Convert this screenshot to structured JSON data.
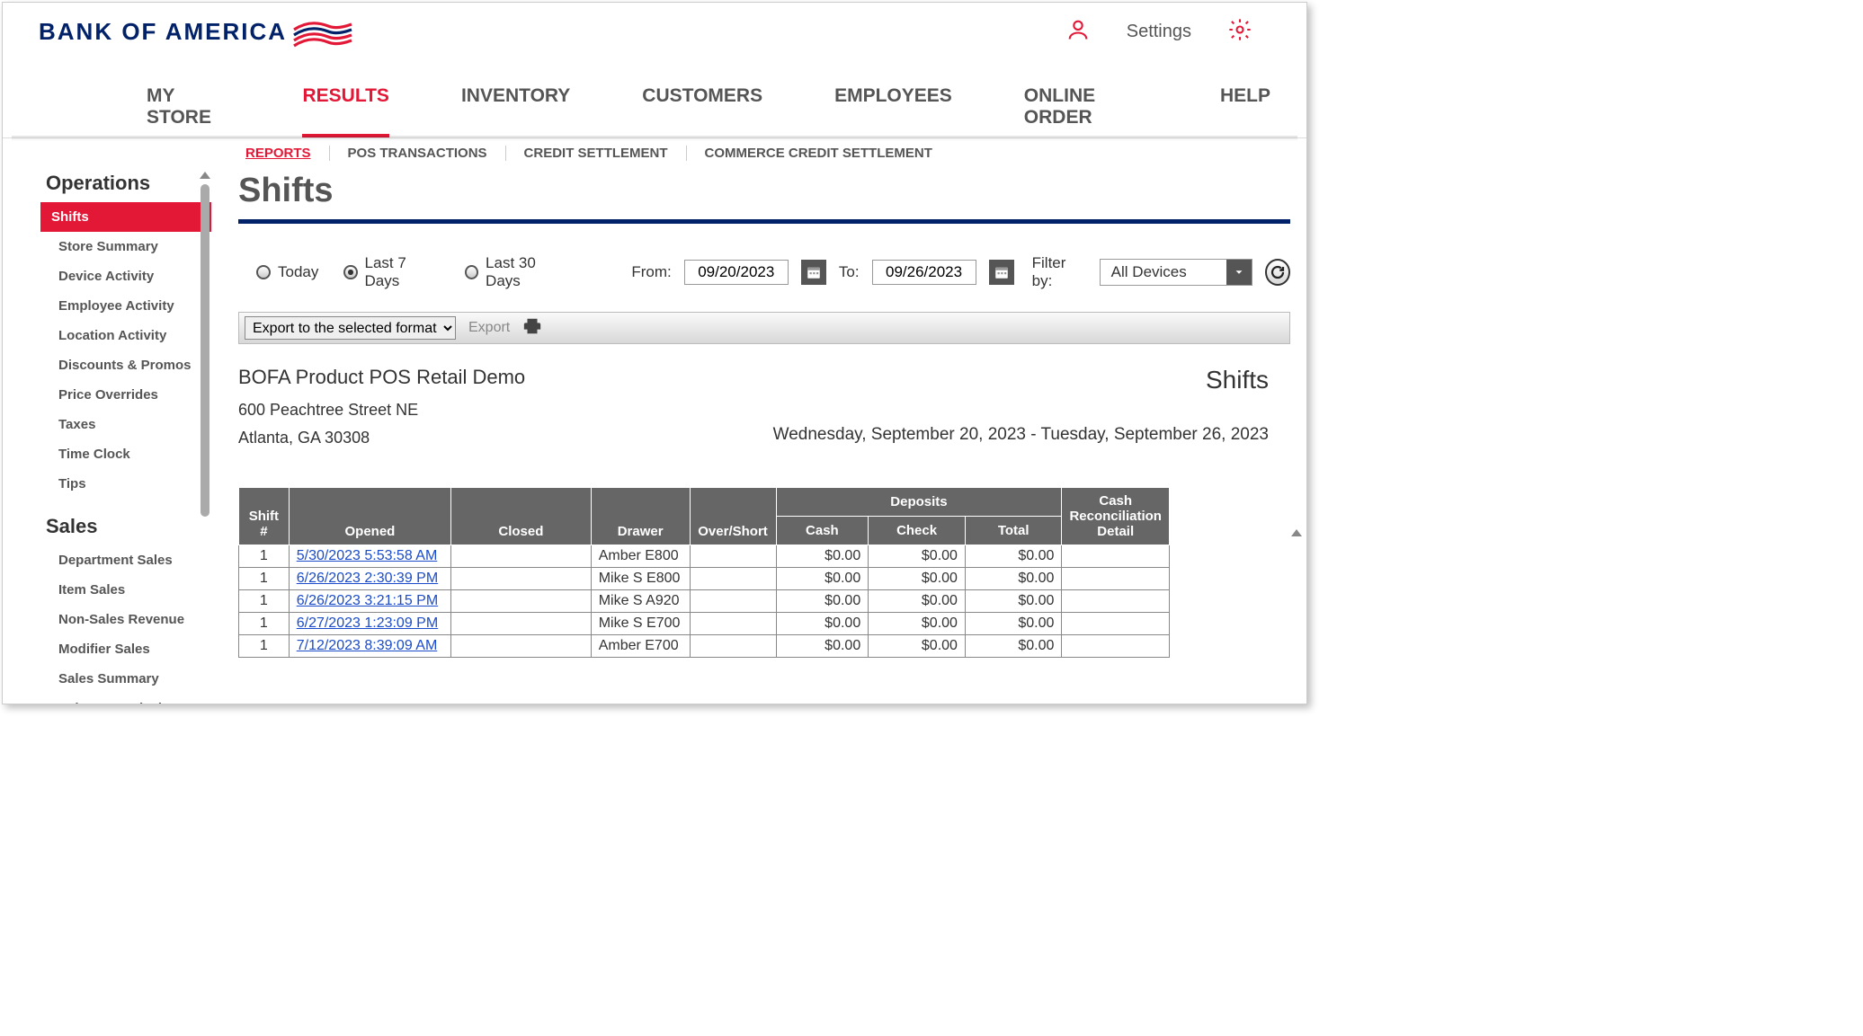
{
  "header": {
    "logo_text": "BANK OF AMERICA",
    "settings": "Settings"
  },
  "mainNav": [
    "MY STORE",
    "RESULTS",
    "INVENTORY",
    "CUSTOMERS",
    "EMPLOYEES",
    "ONLINE ORDER",
    "HELP"
  ],
  "subNav": [
    "REPORTS",
    "POS TRANSACTIONS",
    "CREDIT SETTLEMENT",
    "COMMERCE CREDIT SETTLEMENT"
  ],
  "sidebar": {
    "operations": {
      "title": "Operations",
      "items": [
        "Shifts",
        "Store Summary",
        "Device Activity",
        "Employee Activity",
        "Location Activity",
        "Discounts & Promos",
        "Price Overrides",
        "Taxes",
        "Time Clock",
        "Tips"
      ]
    },
    "sales": {
      "title": "Sales",
      "items": [
        "Department Sales",
        "Item Sales",
        "Non-Sales Revenue",
        "Modifier Sales",
        "Sales Summary",
        "Sales Commissions"
      ]
    }
  },
  "page": {
    "title": "Shifts"
  },
  "filters": {
    "radios": [
      "Today",
      "Last 7 Days",
      "Last 30 Days"
    ],
    "from_label": "From:",
    "from_value": "09/20/2023",
    "to_label": "To:",
    "to_value": "09/26/2023",
    "filter_by_label": "Filter by:",
    "filter_by_value": "All Devices"
  },
  "exportBar": {
    "select": "Export to the selected format",
    "export": "Export"
  },
  "report": {
    "store_name": "BOFA Product POS Retail Demo",
    "addr1": "600 Peachtree Street NE",
    "addr2": "Atlanta, GA 30308",
    "title": "Shifts",
    "date_range": "Wednesday, September 20, 2023 - Tuesday, September 26, 2023"
  },
  "table": {
    "headers": {
      "shift": "Shift #",
      "opened": "Opened",
      "closed": "Closed",
      "drawer": "Drawer",
      "overshort": "Over/Short",
      "deposits": "Deposits",
      "cash": "Cash",
      "check": "Check",
      "total": "Total",
      "recon": "Cash Reconciliation Detail"
    },
    "rows": [
      {
        "shift": "1",
        "opened": "5/30/2023 5:53:58 AM",
        "closed": "",
        "drawer": "Amber E800",
        "overshort": "",
        "cash": "$0.00",
        "check": "$0.00",
        "total": "$0.00",
        "recon": ""
      },
      {
        "shift": "1",
        "opened": "6/26/2023 2:30:39 PM",
        "closed": "",
        "drawer": "Mike S E800",
        "overshort": "",
        "cash": "$0.00",
        "check": "$0.00",
        "total": "$0.00",
        "recon": ""
      },
      {
        "shift": "1",
        "opened": "6/26/2023 3:21:15 PM",
        "closed": "",
        "drawer": "Mike S A920",
        "overshort": "",
        "cash": "$0.00",
        "check": "$0.00",
        "total": "$0.00",
        "recon": ""
      },
      {
        "shift": "1",
        "opened": "6/27/2023 1:23:09 PM",
        "closed": "",
        "drawer": "Mike S E700",
        "overshort": "",
        "cash": "$0.00",
        "check": "$0.00",
        "total": "$0.00",
        "recon": ""
      },
      {
        "shift": "1",
        "opened": "7/12/2023 8:39:09 AM",
        "closed": "",
        "drawer": "Amber E700",
        "overshort": "",
        "cash": "$0.00",
        "check": "$0.00",
        "total": "$0.00",
        "recon": ""
      }
    ]
  }
}
